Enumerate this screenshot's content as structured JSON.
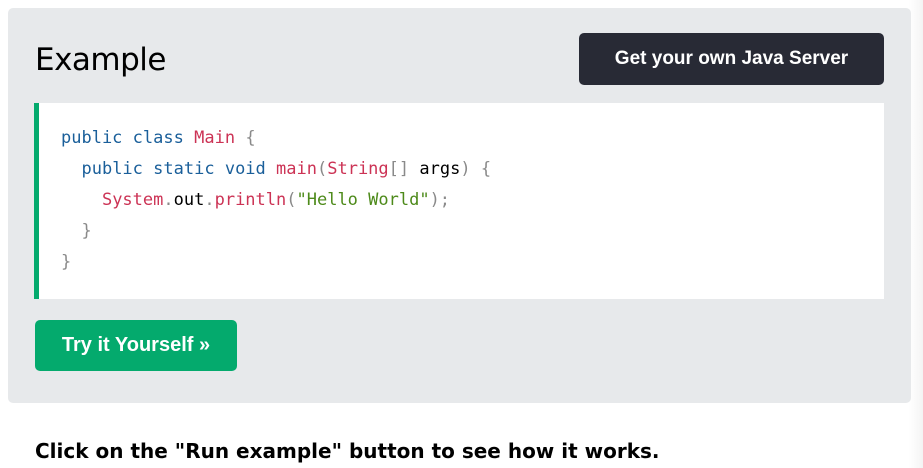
{
  "example": {
    "title": "Example",
    "server_button_label": "Get your own Java Server",
    "try_button_label": "Try it Yourself »",
    "code_language": "Java",
    "code": {
      "line1": {
        "kw1": "public",
        "kw2": "class",
        "cls": "Main",
        "punc": "{"
      },
      "line2": {
        "kw1": "public",
        "kw2": "static",
        "kw3": "void",
        "fn": "main",
        "punc_open": "(",
        "type": "String",
        "brackets": "[]",
        "arg": "args",
        "punc_close": ")",
        "brace": "{"
      },
      "line3": {
        "obj": "System",
        "dot1": ".",
        "field": "out",
        "dot2": ".",
        "fn": "println",
        "punc_open": "(",
        "str": "\"Hello World\"",
        "punc_close": ");"
      },
      "line4": {
        "brace": "}"
      },
      "line5": {
        "brace": "}"
      }
    }
  },
  "instruction_text": "Click on the \"Run example\" button to see how it works.",
  "colors": {
    "card_background": "#e7e9eb",
    "accent_green": "#04aa6d",
    "dark_button": "#282a35",
    "code_keyword": "#1a5f9a",
    "code_class": "#cc3355",
    "code_string": "#4d8a1a",
    "code_punctuation": "#8a8a8a"
  }
}
